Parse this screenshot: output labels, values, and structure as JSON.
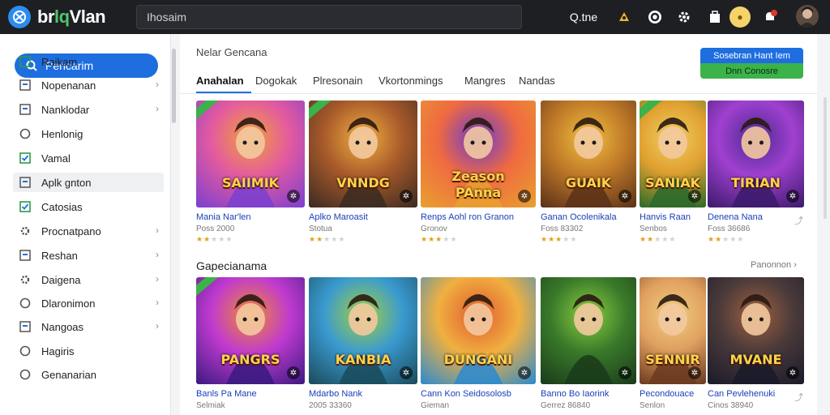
{
  "brand": {
    "logo_text_a": "br",
    "logo_text_b": "lq",
    "logo_text_c": "Vlan"
  },
  "search": {
    "placeholder": "Ihosaim"
  },
  "topbar": {
    "quick_label": "Q.tne",
    "icons": [
      "sparkle-icon",
      "compass-icon",
      "settings-icon",
      "bag-icon",
      "coin-icon",
      "bell-icon",
      "avatar"
    ]
  },
  "sidebar": {
    "search_label": "Pencarim",
    "items": [
      {
        "label": "Raikam",
        "icon": "check-square-icon",
        "chev": false
      },
      {
        "label": "Nopenanan",
        "icon": "square-icon",
        "chev": true
      },
      {
        "label": "Nanklodar",
        "icon": "square-icon",
        "chev": true
      },
      {
        "label": "Henlonig",
        "icon": "circle-icon",
        "chev": false
      },
      {
        "label": "Vamal",
        "icon": "check-square-icon",
        "chev": false
      },
      {
        "label": "Aplk gnton",
        "icon": "square-icon",
        "chev": false,
        "active": true
      },
      {
        "label": "Catosias",
        "icon": "check-square-icon",
        "chev": false
      },
      {
        "label": "Procnatpano",
        "icon": "gear-icon",
        "chev": true
      },
      {
        "label": "Reshan",
        "icon": "square-icon",
        "chev": true
      },
      {
        "label": "Daigena",
        "icon": "gear-icon",
        "chev": true
      },
      {
        "label": "Dlaronimon",
        "icon": "circle-icon",
        "chev": true
      },
      {
        "label": "Nangoas",
        "icon": "square-icon",
        "chev": true
      },
      {
        "label": "Hagiris",
        "icon": "circle-icon",
        "chev": false
      },
      {
        "label": "Genanarian",
        "icon": "circle-icon",
        "chev": false
      }
    ]
  },
  "main": {
    "section_title": "Nelar Gencana",
    "promo": {
      "top": "Sosebran Hant Iem",
      "bottom": "Dnn  Conosre"
    },
    "tabs": [
      "Anahalan",
      "Dogokak",
      "Plresonain",
      "Vkortonmings",
      "Mangres",
      "Nandas"
    ],
    "row1": [
      {
        "art": "SAIIMIK",
        "art2": "",
        "title": "Mania Nar'len",
        "sub": "Poss 2000",
        "stars": 2,
        "tagged": true
      },
      {
        "art": "VNNDG",
        "art2": "",
        "title": "Aplko Maroasit",
        "sub": "Stotua",
        "stars": 2,
        "tagged": true
      },
      {
        "art": "Zeason",
        "art2": "PAnna",
        "title": "Renps Aohl ron Granon",
        "sub": "Gronov",
        "stars": 3,
        "tagged": false
      },
      {
        "art": "GUAIK",
        "art2": "",
        "title": "Ganan Ocolenikala",
        "sub": "Foss 83302",
        "stars": 3,
        "tagged": false
      },
      {
        "art": "SANIAK",
        "art2": "",
        "title": "Hanvis Raan",
        "sub": "Senbos",
        "stars": 2,
        "tagged": true
      },
      {
        "art": "TIRIAN",
        "art2": "",
        "title": "Denena Nana",
        "sub": "Foss 36686",
        "stars": 2,
        "tagged": false
      }
    ],
    "section2_title": "Gapecianama",
    "see_more": "Panonnon",
    "row2": [
      {
        "art": "PANGRS",
        "art2": "",
        "title": "Banls Pa Mane",
        "sub": "Selmiak",
        "tagged": true
      },
      {
        "art": "KANBIA",
        "art2": "",
        "title": "Mdarbo  Nank",
        "sub": "2005 33360",
        "tagged": false
      },
      {
        "art": "DUNGANI",
        "art2": "",
        "title": "Cann Kon Seidosolosb",
        "sub": "Gieman",
        "tagged": false
      },
      {
        "art": "",
        "art2": "",
        "title": "Banno Bo Iaorink",
        "sub": "Gerrez 86840",
        "tagged": false
      },
      {
        "art": "SENNIR",
        "art2": "",
        "title": "Pecondouace",
        "sub": "Senlon",
        "tagged": false
      },
      {
        "art": "MVANE",
        "art2": "",
        "title": "Can Pevlehenuki",
        "sub": "Cinos 38940",
        "tagged": false
      }
    ]
  },
  "colors": {
    "accent": "#1e6ee0",
    "green": "#3bb24a",
    "topbar": "#1d1f23",
    "star": "#e0a21a"
  }
}
